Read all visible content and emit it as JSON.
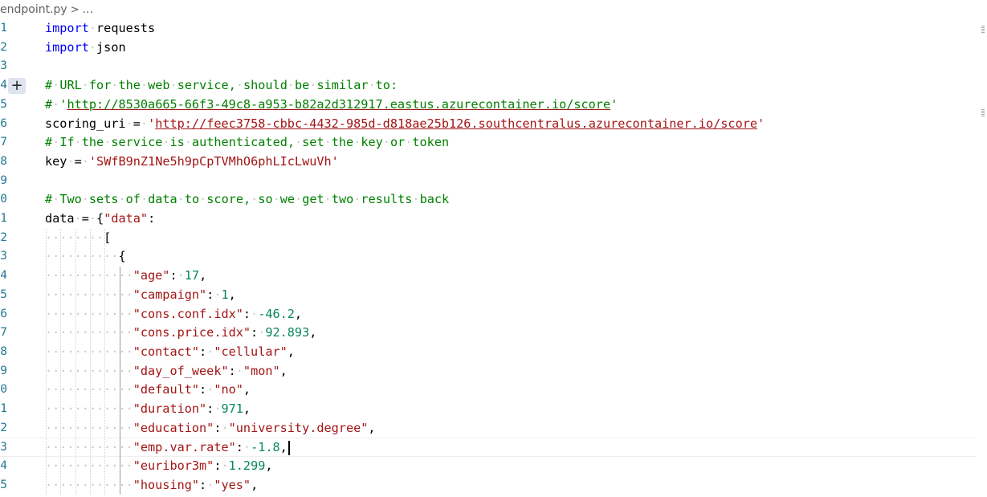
{
  "breadcrumb": {
    "file": "endpoint.py",
    "separator": ">",
    "more": "..."
  },
  "lines": [
    {
      "num": "1",
      "text": "import requests"
    },
    {
      "num": "2",
      "text": "import json"
    },
    {
      "num": "3",
      "text": ""
    },
    {
      "num": "4",
      "text": "# URL for the web service, should be similar to:"
    },
    {
      "num": "5",
      "text": "# 'http://8530a665-66f3-49c8-a953-b82a2d312917.eastus.azurecontainer.io/score'"
    },
    {
      "num": "6",
      "text": "scoring_uri = 'http://feec3758-cbbc-4432-985d-d818ae25b126.southcentralus.azurecontainer.io/score'"
    },
    {
      "num": "7",
      "text": "# If the service is authenticated, set the key or token"
    },
    {
      "num": "8",
      "text": "key = 'SWfB9nZ1Ne5h9pCpTVMhO6phLIcLwuVh'"
    },
    {
      "num": "9",
      "text": ""
    },
    {
      "num": "0",
      "text": "# Two sets of data to score, so we get two results back"
    },
    {
      "num": "1",
      "text": "data = {\"data\":"
    },
    {
      "num": "2",
      "text": "[",
      "indent": 8
    },
    {
      "num": "3",
      "text": "{",
      "indent": 10
    },
    {
      "num": "4",
      "text": "\"age\": 17,",
      "indent": 12
    },
    {
      "num": "5",
      "text": "\"campaign\": 1,",
      "indent": 12
    },
    {
      "num": "6",
      "text": "\"cons.conf.idx\": -46.2,",
      "indent": 12
    },
    {
      "num": "7",
      "text": "\"cons.price.idx\": 92.893,",
      "indent": 12
    },
    {
      "num": "8",
      "text": "\"contact\": \"cellular\",",
      "indent": 12
    },
    {
      "num": "9",
      "text": "\"day_of_week\": \"mon\",",
      "indent": 12
    },
    {
      "num": "0",
      "text": "\"default\": \"no\",",
      "indent": 12
    },
    {
      "num": "1",
      "text": "\"duration\": 971,",
      "indent": 12
    },
    {
      "num": "2",
      "text": "\"education\": \"university.degree\",",
      "indent": 12
    },
    {
      "num": "3",
      "text": "\"emp.var.rate\": -1.8,",
      "indent": 12
    },
    {
      "num": "4",
      "text": "\"euribor3m\": 1.299,",
      "indent": 12
    },
    {
      "num": "5",
      "text": "\"housing\": \"yes\",",
      "indent": 12
    }
  ],
  "colors": {
    "keyword": "#0000ff",
    "string": "#a31515",
    "comment": "#008000",
    "number": "#098658",
    "line_number": "#237893"
  },
  "fold_icon": "plus-icon"
}
